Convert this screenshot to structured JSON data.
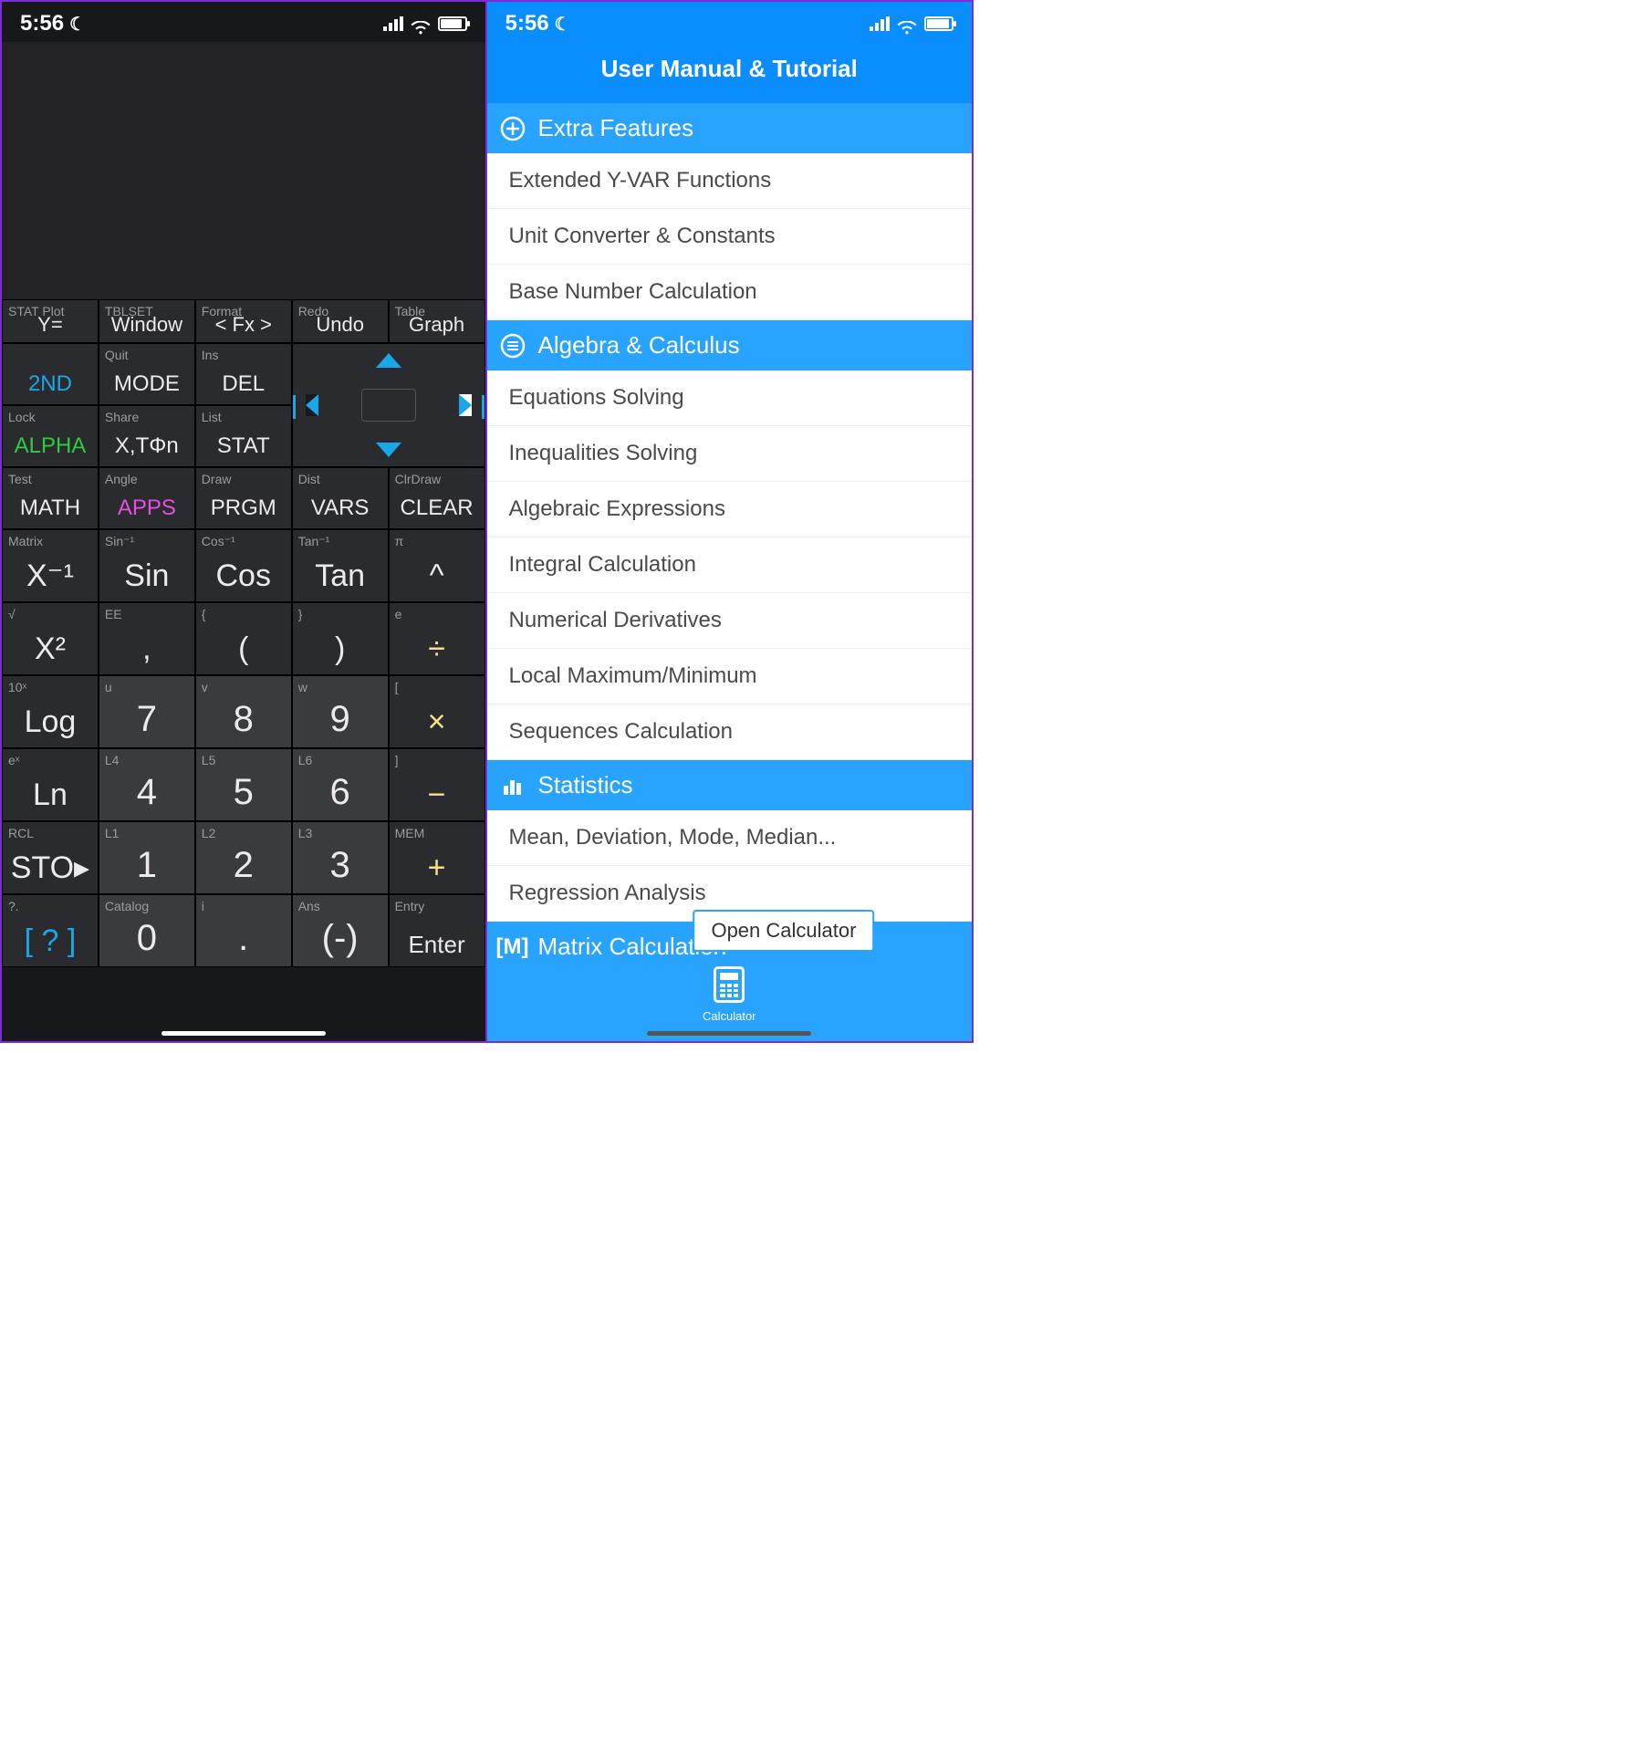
{
  "status_time": "5:56",
  "left": {
    "row1": [
      {
        "sub": "STAT Plot",
        "main": "Y="
      },
      {
        "sub": "TBLSET",
        "main": "Window"
      },
      {
        "sub": "Format",
        "main": "< Fx >"
      },
      {
        "sub": "Redo",
        "main": "Undo"
      },
      {
        "sub": "Table",
        "main": "Graph"
      }
    ],
    "row2": [
      {
        "sub": "",
        "main": "2ND"
      },
      {
        "sub": "Quit",
        "main": "MODE"
      },
      {
        "sub": "Ins",
        "main": "DEL"
      }
    ],
    "row3": [
      {
        "sub": "Lock",
        "main": "ALPHA"
      },
      {
        "sub": "Share",
        "main": "X,TΦn"
      },
      {
        "sub": "List",
        "main": "STAT"
      }
    ],
    "row4": [
      {
        "sub": "Test",
        "main": "MATH"
      },
      {
        "sub": "Angle",
        "main": "APPS"
      },
      {
        "sub": "Draw",
        "main": "PRGM"
      },
      {
        "sub": "Dist",
        "main": "VARS"
      },
      {
        "sub": "ClrDraw",
        "main": "CLEAR"
      }
    ],
    "row5": [
      {
        "sub": "Matrix",
        "main": "X⁻¹"
      },
      {
        "sub": "Sin⁻¹",
        "main": "Sin"
      },
      {
        "sub": "Cos⁻¹",
        "main": "Cos"
      },
      {
        "sub": "Tan⁻¹",
        "main": "Tan"
      },
      {
        "sub": "π",
        "main": "^"
      }
    ],
    "row6": [
      {
        "sub": "√",
        "main": "X²"
      },
      {
        "sub": "EE",
        "main": ","
      },
      {
        "sub": "{",
        "main": "("
      },
      {
        "sub": "}",
        "main": ")"
      },
      {
        "sub": "e",
        "main": "÷"
      }
    ],
    "row7": [
      {
        "sub": "10ˣ",
        "main": "Log"
      },
      {
        "sub": "u",
        "main": "7"
      },
      {
        "sub": "v",
        "main": "8"
      },
      {
        "sub": "w",
        "main": "9"
      },
      {
        "sub": "[",
        "main": "×"
      }
    ],
    "row8": [
      {
        "sub": "eˣ",
        "main": "Ln"
      },
      {
        "sub": "L4",
        "main": "4"
      },
      {
        "sub": "L5",
        "main": "5"
      },
      {
        "sub": "L6",
        "main": "6"
      },
      {
        "sub": "]",
        "main": "−"
      }
    ],
    "row9": [
      {
        "sub": "RCL",
        "main": "STO▸"
      },
      {
        "sub": "L1",
        "main": "1"
      },
      {
        "sub": "L2",
        "main": "2"
      },
      {
        "sub": "L3",
        "main": "3"
      },
      {
        "sub": "MEM",
        "main": "+"
      }
    ],
    "row10": [
      {
        "sub": "?.",
        "main": "[ ? ]"
      },
      {
        "sub": "Catalog",
        "main": "0"
      },
      {
        "sub": "i",
        "main": "."
      },
      {
        "sub": "Ans",
        "main": "(-)"
      },
      {
        "sub": "Entry",
        "main": "Enter"
      }
    ]
  },
  "right": {
    "title": "User Manual & Tutorial",
    "sections": [
      {
        "icon": "plus",
        "label": "Extra Features",
        "items": [
          "Extended Y-VAR Functions",
          "Unit Converter & Constants",
          "Base Number Calculation"
        ]
      },
      {
        "icon": "menu",
        "label": "Algebra & Calculus",
        "items": [
          "Equations Solving",
          "Inequalities Solving",
          "Algebraic Expressions",
          "Integral Calculation",
          "Numerical Derivatives",
          "Local Maximum/Minimum",
          "Sequences Calculation"
        ]
      },
      {
        "icon": "bars",
        "label": "Statistics",
        "items": [
          "Mean, Deviation, Mode, Median...",
          "Regression Analysis"
        ]
      },
      {
        "icon": "M",
        "label": "Matrix Calculation",
        "items": []
      }
    ],
    "tooltip": "Open Calculator",
    "tab_label": "Calculator"
  }
}
